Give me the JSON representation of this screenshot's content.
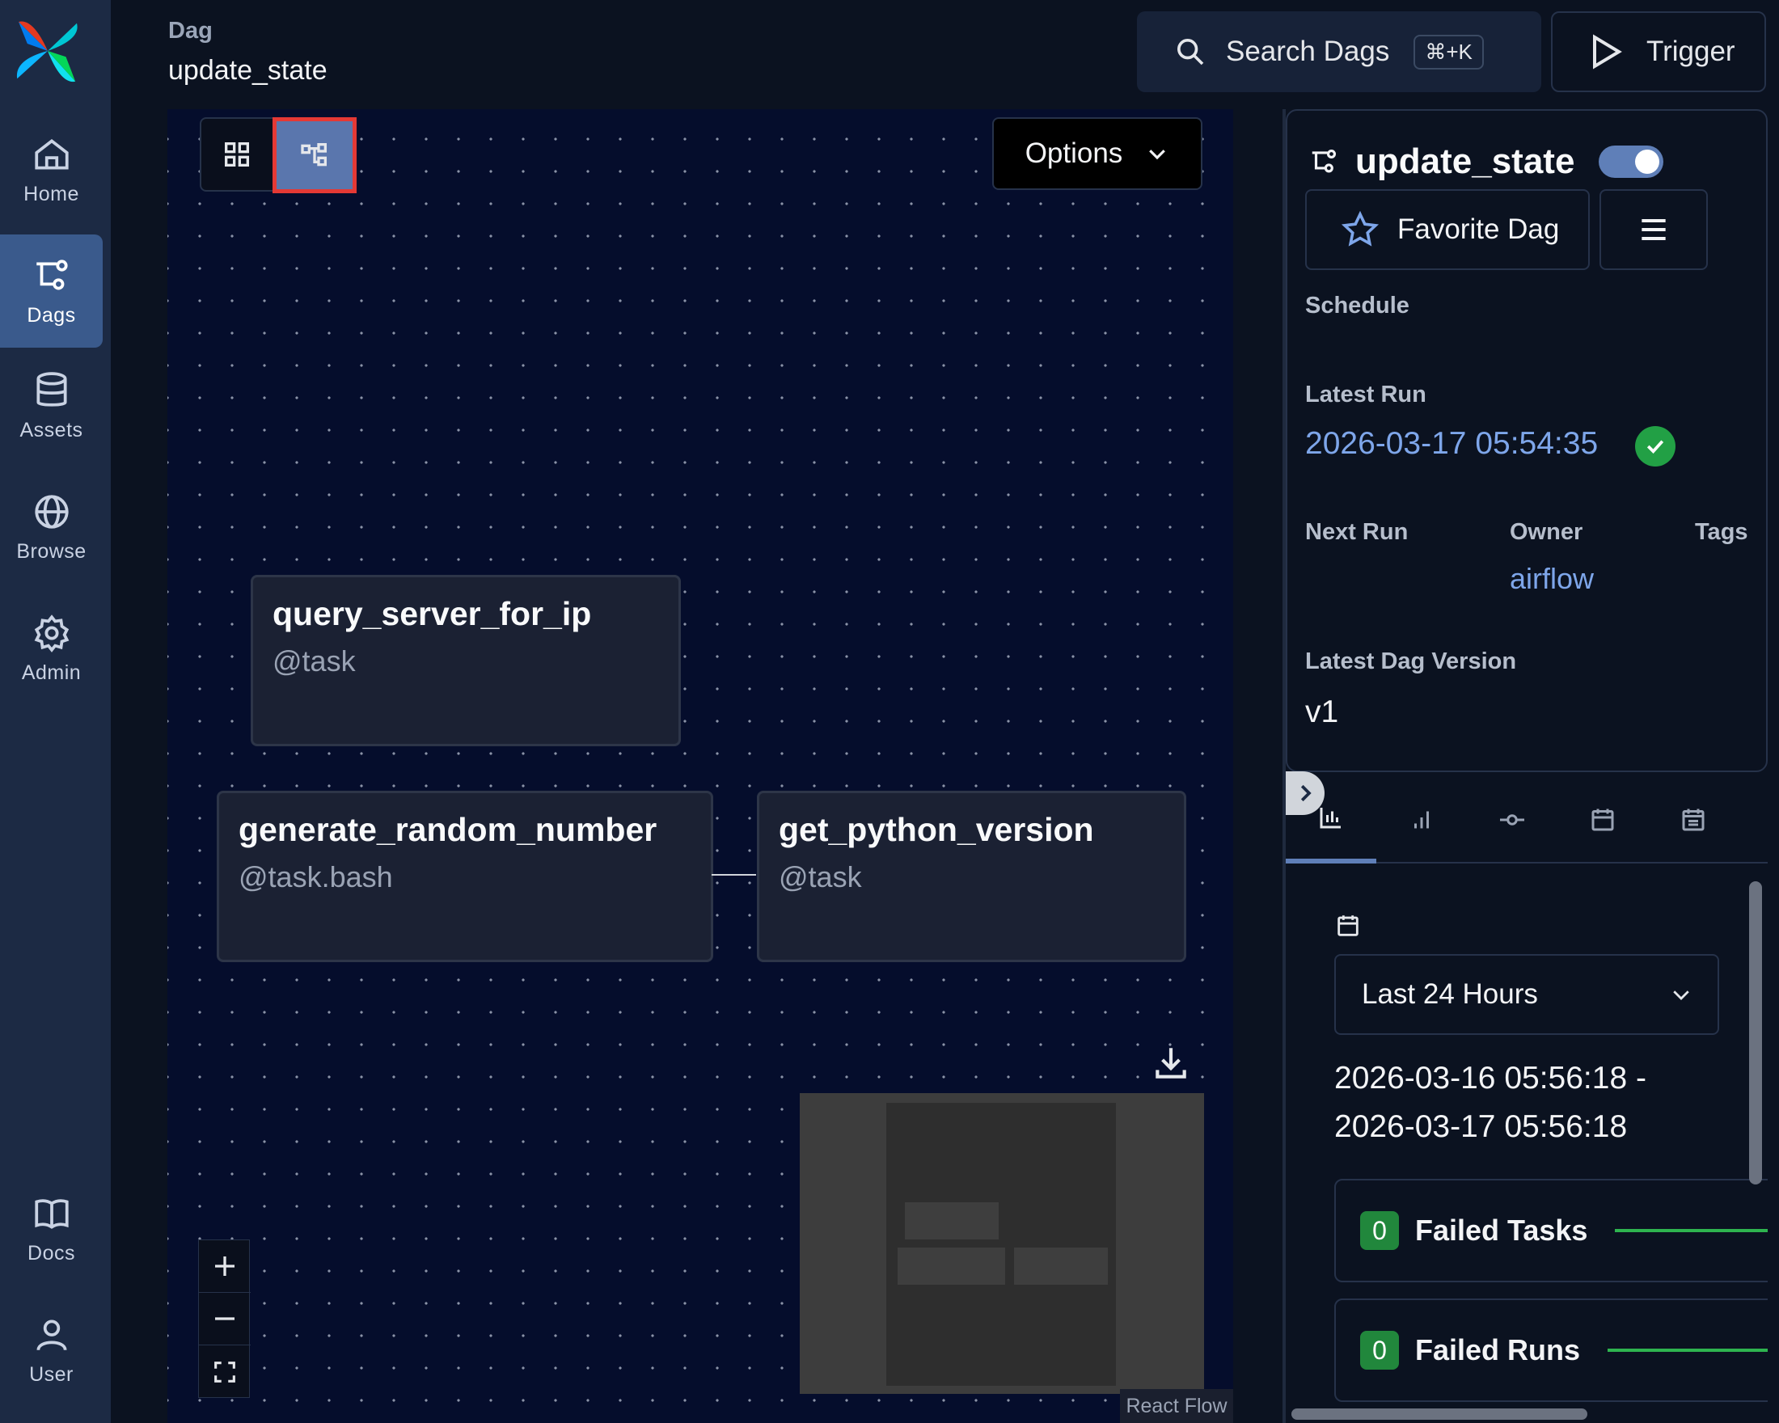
{
  "sidebar": {
    "items": [
      {
        "label": "Home",
        "icon": "home-icon"
      },
      {
        "label": "Dags",
        "icon": "dags-icon",
        "active": true
      },
      {
        "label": "Assets",
        "icon": "database-icon"
      },
      {
        "label": "Browse",
        "icon": "globe-icon"
      },
      {
        "label": "Admin",
        "icon": "gear-icon"
      },
      {
        "label": "Docs",
        "icon": "book-icon"
      },
      {
        "label": "User",
        "icon": "user-icon"
      }
    ]
  },
  "header": {
    "breadcrumb_label": "Dag",
    "breadcrumb_title": "update_state",
    "search_label": "Search Dags",
    "search_shortcut": "⌘+K",
    "trigger_label": "Trigger"
  },
  "graph": {
    "options_label": "Options",
    "nodes": [
      {
        "name": "query_server_for_ip",
        "type": "@task"
      },
      {
        "name": "generate_random_number",
        "type": "@task.bash"
      },
      {
        "name": "get_python_version",
        "type": "@task"
      }
    ],
    "attribution": "React Flow"
  },
  "details": {
    "dag_name": "update_state",
    "paused": false,
    "favorite_label": "Favorite Dag",
    "schedule_label": "Schedule",
    "latest_run_label": "Latest Run",
    "latest_run_value": "2026-03-17 05:54:35",
    "latest_run_status": "success",
    "next_run_label": "Next Run",
    "owner_label": "Owner",
    "owner_value": "airflow",
    "tags_label": "Tags",
    "version_label": "Latest Dag Version",
    "version_value": "v1"
  },
  "stats": {
    "range_select": "Last 24 Hours",
    "range_start": "2026-03-16 05:56:18 -",
    "range_end": "2026-03-17 05:56:18",
    "cards": [
      {
        "count": "0",
        "label": "Failed Tasks"
      },
      {
        "count": "0",
        "label": "Failed Runs"
      }
    ]
  },
  "colors": {
    "accent": "#5f7fb8",
    "success": "#22a045",
    "link": "#7ea6ea",
    "highlight_border": "#e53935"
  }
}
